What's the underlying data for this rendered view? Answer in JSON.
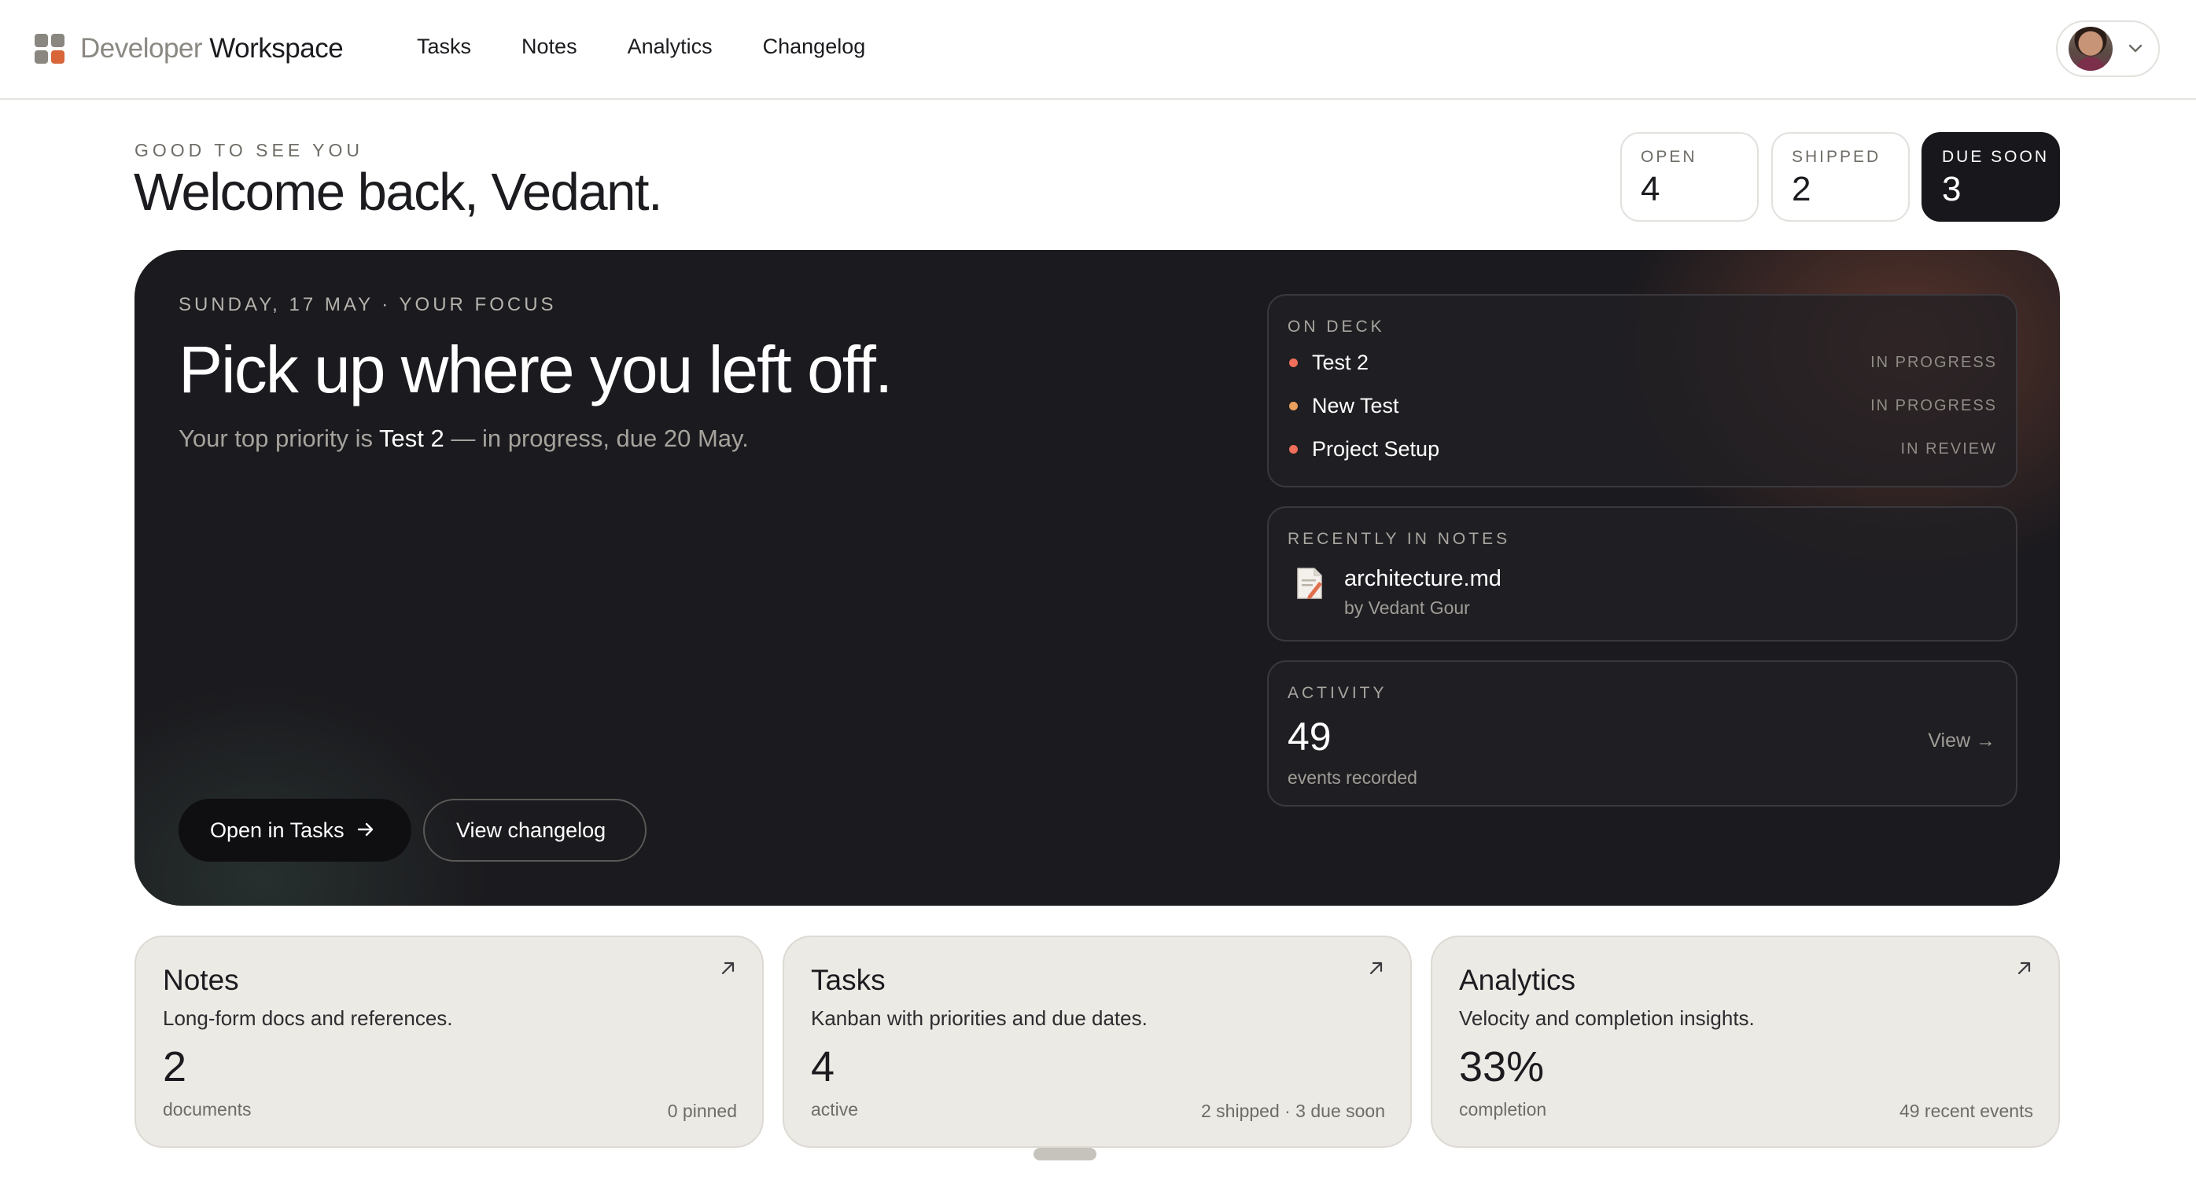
{
  "brand": {
    "light": "Developer",
    "dark": "Workspace"
  },
  "nav": [
    "Tasks",
    "Notes",
    "Analytics",
    "Changelog"
  ],
  "greeting": {
    "eyebrow": "GOOD TO SEE YOU",
    "title": "Welcome back, Vedant."
  },
  "stats": [
    {
      "label": "OPEN",
      "value": "4"
    },
    {
      "label": "SHIPPED",
      "value": "2"
    },
    {
      "label": "DUE SOON",
      "value": "3"
    }
  ],
  "hero": {
    "eyebrow": "SUNDAY, 17 MAY · YOUR FOCUS",
    "title": "Pick up where you left off.",
    "sub_prefix": "Your top priority is ",
    "sub_task": "Test 2",
    "sub_suffix": " — in progress, due 20 May.",
    "primary_button": "Open in Tasks",
    "secondary_button": "View changelog"
  },
  "on_deck": {
    "label": "ON DECK",
    "items": [
      {
        "name": "Test 2",
        "status": "IN PROGRESS",
        "dot_color": "#ef6f5a"
      },
      {
        "name": "New Test",
        "status": "IN PROGRESS",
        "dot_color": "#e9a15d"
      },
      {
        "name": "Project Setup",
        "status": "IN REVIEW",
        "dot_color": "#ef6f5a"
      }
    ]
  },
  "recent_notes": {
    "label": "RECENTLY IN NOTES",
    "name": "architecture.md",
    "author": "by Vedant Gour"
  },
  "activity": {
    "label": "ACTIVITY",
    "count": "49",
    "sub": "events recorded",
    "link": "View →"
  },
  "cards": [
    {
      "title": "Notes",
      "desc": "Long-form docs and references.",
      "num": "2",
      "unit": "documents",
      "meta": "0 pinned"
    },
    {
      "title": "Tasks",
      "desc": "Kanban with priorities and due dates.",
      "num": "4",
      "unit": "active",
      "meta": "2 shipped · 3 due soon"
    },
    {
      "title": "Analytics",
      "desc": "Velocity and completion insights.",
      "num": "33%",
      "unit": "completion",
      "meta": "49 recent events"
    }
  ],
  "colors": {
    "accent": "#d9653b",
    "hero_bg": "#1b1a1e",
    "card_bg": "#eceae5"
  }
}
